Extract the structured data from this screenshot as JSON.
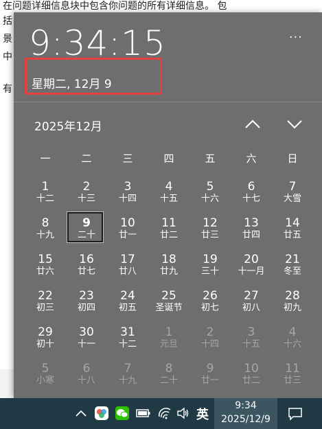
{
  "background_doc": {
    "lines": [
      "在问题详细信息块中包含你问题的所有详细信息。 包",
      "括",
      "景",
      "中",
      "有"
    ]
  },
  "flyout": {
    "clock": "9:34:15",
    "more": "···",
    "date_long": "星期二, 12月 9",
    "month_title": "2025年12月",
    "weekdays": [
      "一",
      "二",
      "三",
      "四",
      "五",
      "六",
      "日"
    ],
    "weeks": [
      [
        {
          "n": "1",
          "l": "十二"
        },
        {
          "n": "2",
          "l": "十三"
        },
        {
          "n": "3",
          "l": "十四"
        },
        {
          "n": "4",
          "l": "十五"
        },
        {
          "n": "5",
          "l": "十六"
        },
        {
          "n": "6",
          "l": "十七"
        },
        {
          "n": "7",
          "l": "大雪"
        }
      ],
      [
        {
          "n": "8",
          "l": "十九"
        },
        {
          "n": "9",
          "l": "二十"
        },
        {
          "n": "10",
          "l": "廿一"
        },
        {
          "n": "11",
          "l": "廿二"
        },
        {
          "n": "12",
          "l": "廿三"
        },
        {
          "n": "13",
          "l": "廿四"
        },
        {
          "n": "14",
          "l": "廿五"
        }
      ],
      [
        {
          "n": "15",
          "l": "廿六"
        },
        {
          "n": "16",
          "l": "廿七"
        },
        {
          "n": "17",
          "l": "廿八"
        },
        {
          "n": "18",
          "l": "廿九"
        },
        {
          "n": "19",
          "l": "三十"
        },
        {
          "n": "20",
          "l": "十一月"
        },
        {
          "n": "21",
          "l": "冬至"
        }
      ],
      [
        {
          "n": "22",
          "l": "初三"
        },
        {
          "n": "23",
          "l": "初四"
        },
        {
          "n": "24",
          "l": "初五"
        },
        {
          "n": "25",
          "l": "圣诞节"
        },
        {
          "n": "26",
          "l": "初七"
        },
        {
          "n": "27",
          "l": "初八"
        },
        {
          "n": "28",
          "l": "初九"
        }
      ],
      [
        {
          "n": "29",
          "l": "初十"
        },
        {
          "n": "30",
          "l": "十一"
        },
        {
          "n": "31",
          "l": "十二"
        },
        {
          "n": "1",
          "l": "元旦"
        },
        {
          "n": "2",
          "l": "十四"
        },
        {
          "n": "3",
          "l": "十五"
        },
        {
          "n": "4",
          "l": "十六"
        }
      ],
      [
        {
          "n": "5",
          "l": "小寒"
        },
        {
          "n": "6",
          "l": "十八"
        },
        {
          "n": "7",
          "l": "十九"
        },
        {
          "n": "8",
          "l": "二十"
        },
        {
          "n": "9",
          "l": "廿一"
        },
        {
          "n": "10",
          "l": "廿二"
        },
        {
          "n": "11",
          "l": "廿三"
        }
      ]
    ],
    "today_index": [
      1,
      1
    ]
  },
  "taskbar": {
    "ime": "英",
    "time": "9:34",
    "date": "2025/12/9",
    "icons": [
      "chevron-up-icon",
      "colorful-app-icon",
      "wechat-icon",
      "battery-icon",
      "wifi-icon",
      "volume-icon",
      "notification-icon"
    ],
    "accent": "#1f3a44"
  },
  "colors": {
    "flyout_bg": "#6e6e6e",
    "highlight_box": "#e4413f",
    "wechat": "#2dc100"
  }
}
